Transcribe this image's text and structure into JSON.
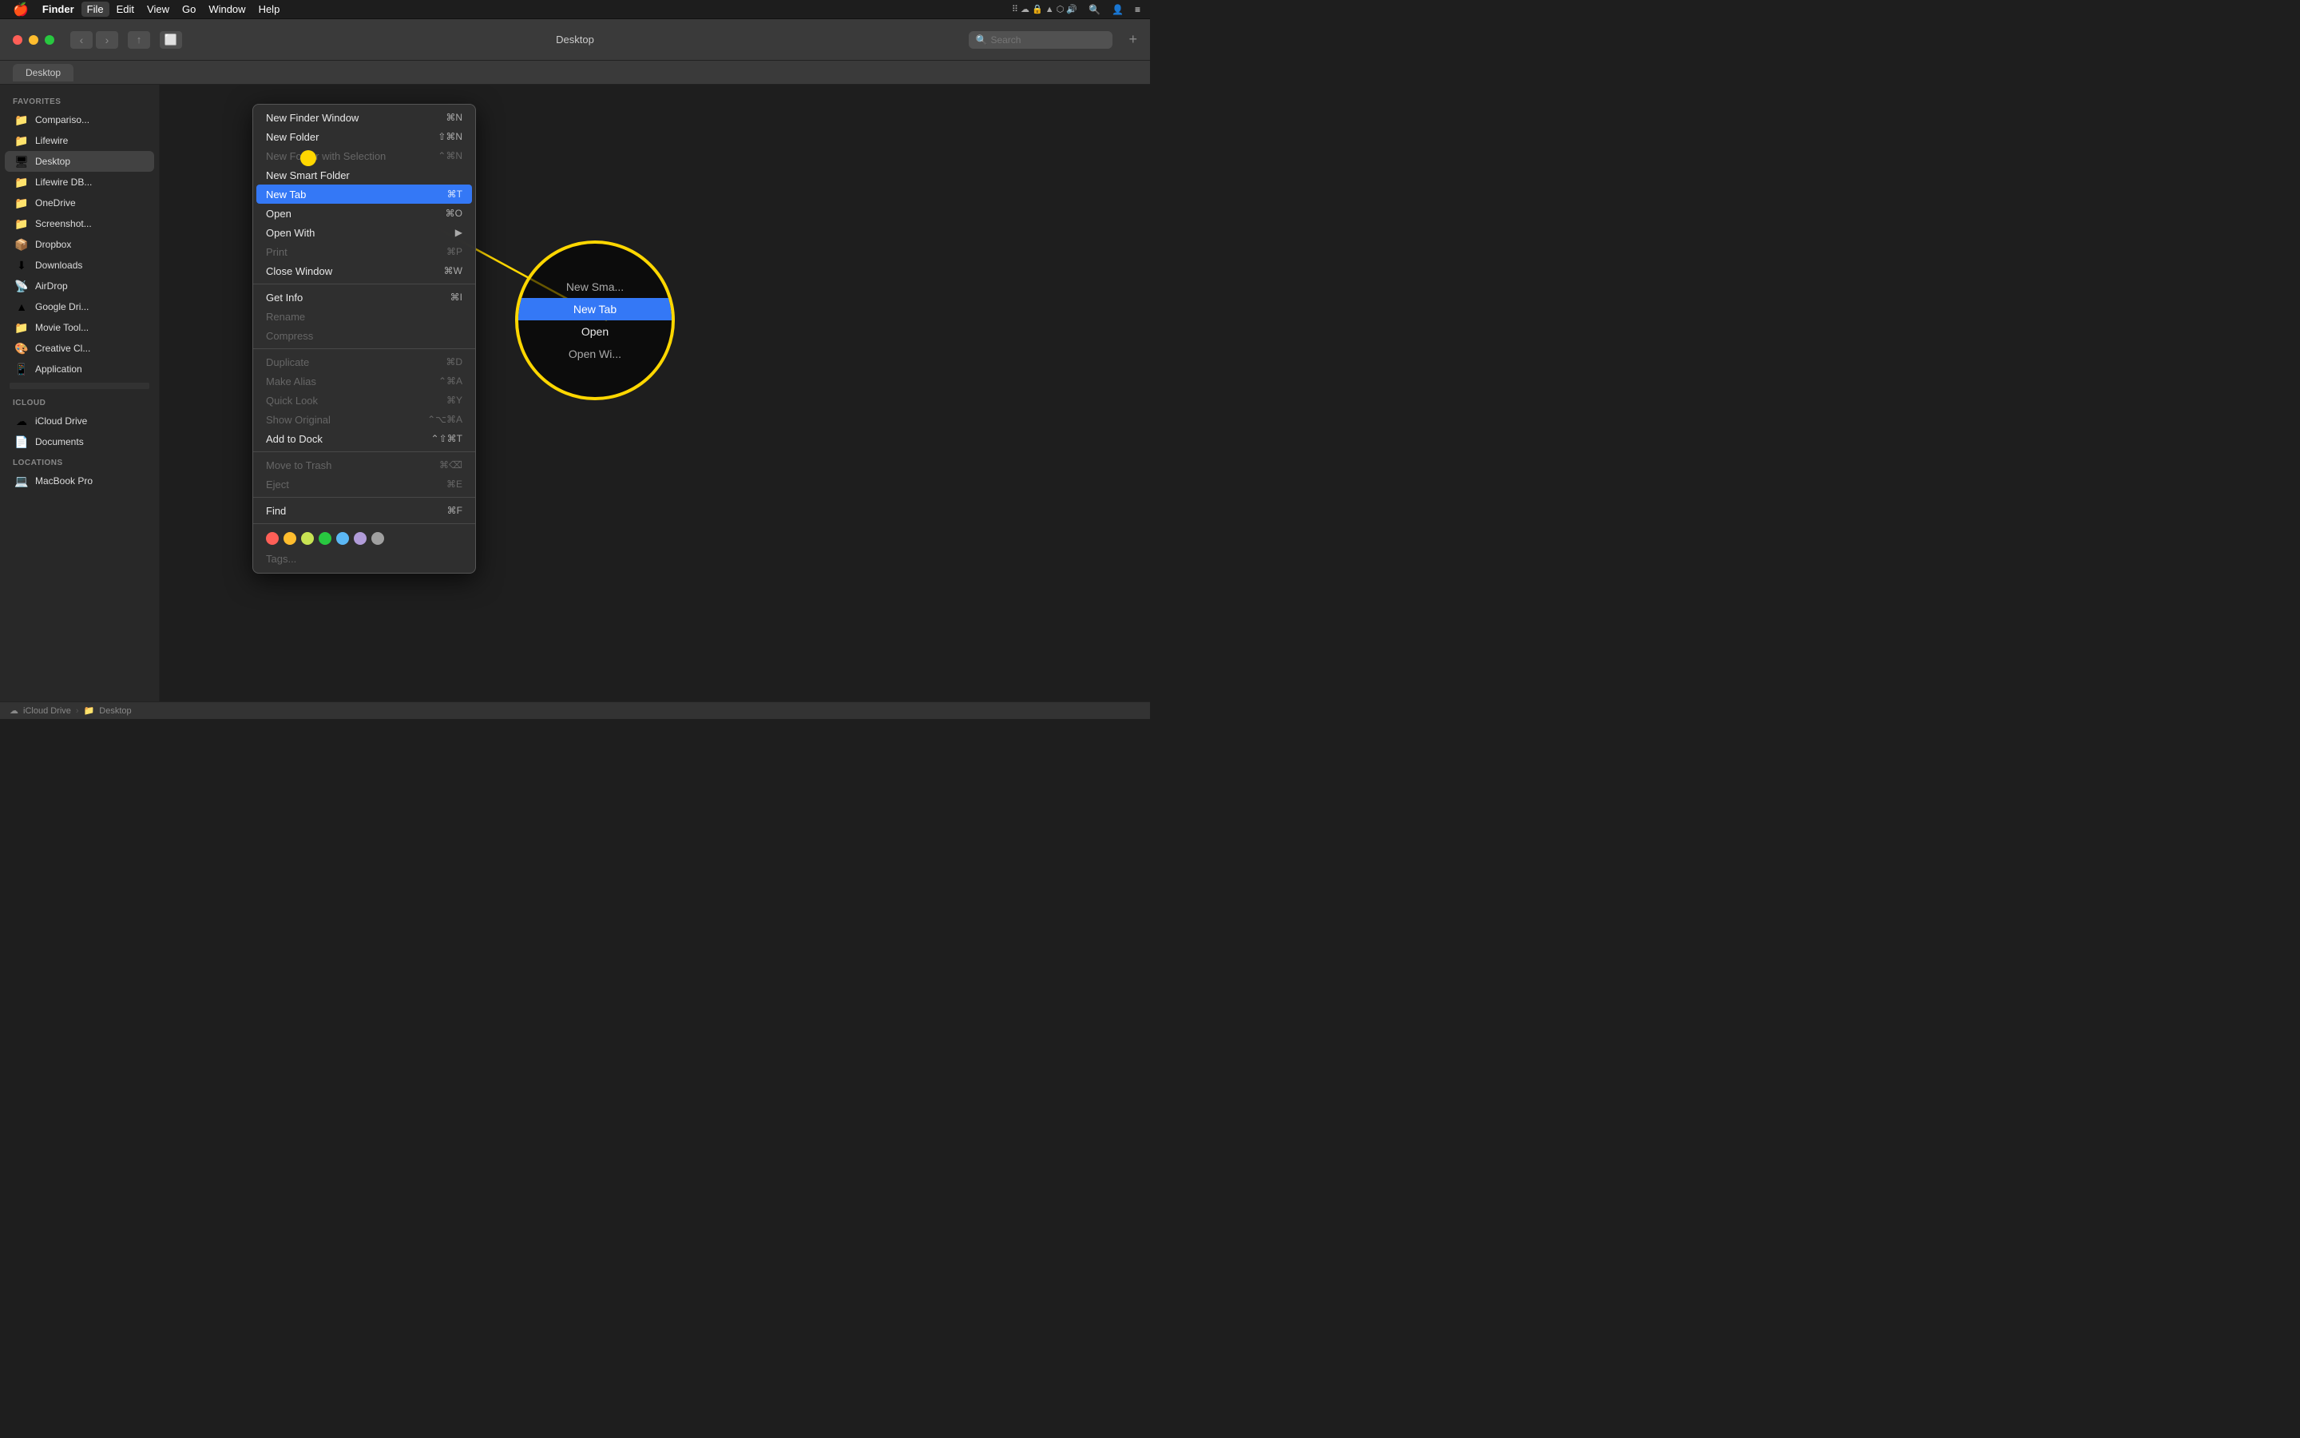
{
  "menubar": {
    "apple_symbol": "🍎",
    "items": [
      {
        "label": "Finder",
        "active": false
      },
      {
        "label": "File",
        "active": true
      },
      {
        "label": "Edit",
        "active": false
      },
      {
        "label": "View",
        "active": false
      },
      {
        "label": "Go",
        "active": false
      },
      {
        "label": "Window",
        "active": false
      },
      {
        "label": "Help",
        "active": false
      }
    ],
    "right_icons": [
      "⠿",
      "☁",
      "🔒",
      "▲",
      "⬡",
      "🔊",
      "🔍",
      "👤",
      "≡"
    ]
  },
  "toolbar": {
    "title": "Desktop",
    "search_placeholder": "Search"
  },
  "tabbar": {
    "tab_label": "Desktop"
  },
  "sidebar": {
    "favorites_header": "Favorites",
    "items": [
      {
        "label": "Compariso...",
        "icon": "📁"
      },
      {
        "label": "Lifewire",
        "icon": "📁"
      },
      {
        "label": "Desktop",
        "icon": "🖥",
        "active": true
      },
      {
        "label": "Lifewire DB...",
        "icon": "📁"
      },
      {
        "label": "OneDrive",
        "icon": "📁"
      },
      {
        "label": "Screenshot...",
        "icon": "📁"
      },
      {
        "label": "Dropbox",
        "icon": "📦"
      },
      {
        "label": "Downloads",
        "icon": "⬇"
      },
      {
        "label": "AirDrop",
        "icon": "📡"
      },
      {
        "label": "Google Dri...",
        "icon": "▲"
      },
      {
        "label": "Movie Tool...",
        "icon": "📁"
      },
      {
        "label": "Creative Cl...",
        "icon": "🎨"
      },
      {
        "label": "Application",
        "icon": "📱"
      }
    ],
    "icloud_header": "iCloud",
    "icloud_items": [
      {
        "label": "iCloud Drive",
        "icon": "☁"
      },
      {
        "label": "Documents",
        "icon": "📄"
      }
    ],
    "locations_header": "Locations",
    "location_items": [
      {
        "label": "MacBook Pro",
        "icon": "💻"
      }
    ]
  },
  "dropdown": {
    "items": [
      {
        "label": "New Finder Window",
        "shortcut": "⌘N",
        "disabled": false
      },
      {
        "label": "New Folder",
        "shortcut": "⇧⌘N",
        "disabled": false
      },
      {
        "label": "New Folder with Selection",
        "shortcut": "⌃⌘N",
        "disabled": true
      },
      {
        "label": "New Smart Folder",
        "shortcut": "",
        "disabled": false
      },
      {
        "label": "New Tab",
        "shortcut": "⌘T",
        "highlighted": true,
        "disabled": false
      },
      {
        "label": "Open",
        "shortcut": "⌘O",
        "disabled": false
      },
      {
        "label": "Open With",
        "shortcut": "",
        "has_arrow": true,
        "disabled": false
      },
      {
        "label": "Print",
        "shortcut": "⌘P",
        "disabled": true
      },
      {
        "label": "Close Window",
        "shortcut": "⌘W",
        "disabled": false
      },
      {
        "sep": true
      },
      {
        "label": "Get Info",
        "shortcut": "⌘I",
        "disabled": false
      },
      {
        "label": "Rename",
        "shortcut": "",
        "disabled": true
      },
      {
        "label": "Compress",
        "shortcut": "",
        "disabled": true
      },
      {
        "sep": true
      },
      {
        "label": "Duplicate",
        "shortcut": "⌘D",
        "disabled": true
      },
      {
        "label": "Make Alias",
        "shortcut": "⌃⌘A",
        "disabled": true
      },
      {
        "label": "Quick Look",
        "shortcut": "⌘Y",
        "disabled": true
      },
      {
        "label": "Show Original",
        "shortcut": "⌃⌥⌘A",
        "disabled": true
      },
      {
        "label": "Add to Dock",
        "shortcut": "⌃⇧⌘T",
        "disabled": false
      },
      {
        "sep": true
      },
      {
        "label": "Move to Trash",
        "shortcut": "⌘⌫",
        "disabled": true
      },
      {
        "label": "Eject",
        "shortcut": "⌘E",
        "disabled": true
      },
      {
        "sep": true
      },
      {
        "label": "Find",
        "shortcut": "⌘F",
        "disabled": false
      },
      {
        "sep": true
      }
    ],
    "tags_label": "Tags...",
    "tag_colors": [
      "#ff5f57",
      "#ffbd2e",
      "#c8e353",
      "#28c840",
      "#5bb8f5",
      "#b19cd9",
      "#a0a0a0"
    ]
  },
  "zoom_items": [
    {
      "label": "New Sma...",
      "partial": true
    },
    {
      "label": "New Tab",
      "highlighted": true
    },
    {
      "label": "Open",
      "partial": false
    },
    {
      "label": "Open Wi...",
      "partial": true
    }
  ],
  "statusbar": {
    "icon": "☁",
    "path_parts": [
      "iCloud Drive",
      "Desktop"
    ]
  }
}
